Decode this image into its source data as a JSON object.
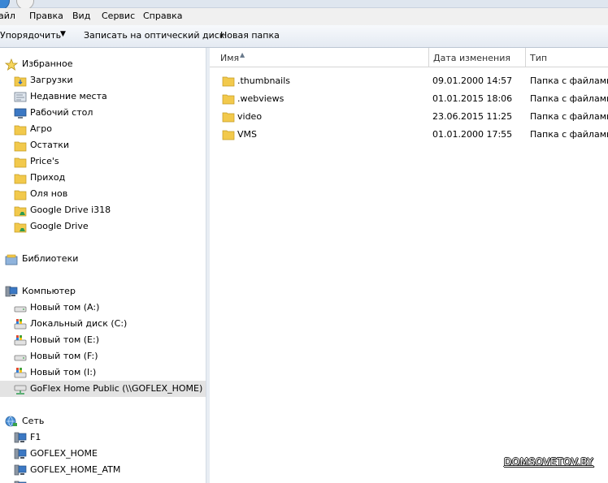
{
  "menu": [
    "Файл",
    "Правка",
    "Вид",
    "Сервис",
    "Справка"
  ],
  "menu_visible": [
    "айл",
    "Правка",
    "Вид",
    "Сервис",
    "Справка"
  ],
  "toolbar": {
    "organize": "Упорядочить",
    "burn": "Записать на оптический диск",
    "new_folder": "Новая папка"
  },
  "nav": {
    "favorites": {
      "label": "Избранное",
      "items": [
        "Загрузки",
        "Недавние места",
        "Рабочий стол",
        "Агро",
        "Остатки",
        "Price's",
        "Приход",
        "Оля нов",
        "Google Drive i318",
        "Google Drive"
      ]
    },
    "libraries": {
      "label": "Библиотеки"
    },
    "computer": {
      "label": "Компьютер",
      "items": [
        "Новый том (A:)",
        "Локальный диск (C:)",
        "Новый том (E:)",
        "Новый том (F:)",
        "Новый том (I:)",
        "GoFlex Home Public (\\\\GOFLEX_HOME) (Z:)"
      ],
      "selected_index": 5
    },
    "network": {
      "label": "Сеть",
      "items": [
        "F1",
        "GOFLEX_HOME",
        "GOFLEX_HOME_ATM"
      ]
    }
  },
  "columns": {
    "name": "Имя",
    "date": "Дата изменения",
    "type": "Тип"
  },
  "files": [
    {
      "name": ".thumbnails",
      "date": "09.01.2000 14:57",
      "type": "Папка с файлами"
    },
    {
      "name": ".webviews",
      "date": "01.01.2015 18:06",
      "type": "Папка с файлами"
    },
    {
      "name": "video",
      "date": "23.06.2015 11:25",
      "type": "Папка с файлами"
    },
    {
      "name": "VMS",
      "date": "01.01.2000 17:55",
      "type": "Папка с файлами"
    }
  ],
  "watermark": "DOMSOVETOV.BY",
  "colors": {
    "folder": "#f2c94c",
    "selected_row": "#e3e3e3",
    "toolbar_border": "#bcc6d3"
  }
}
